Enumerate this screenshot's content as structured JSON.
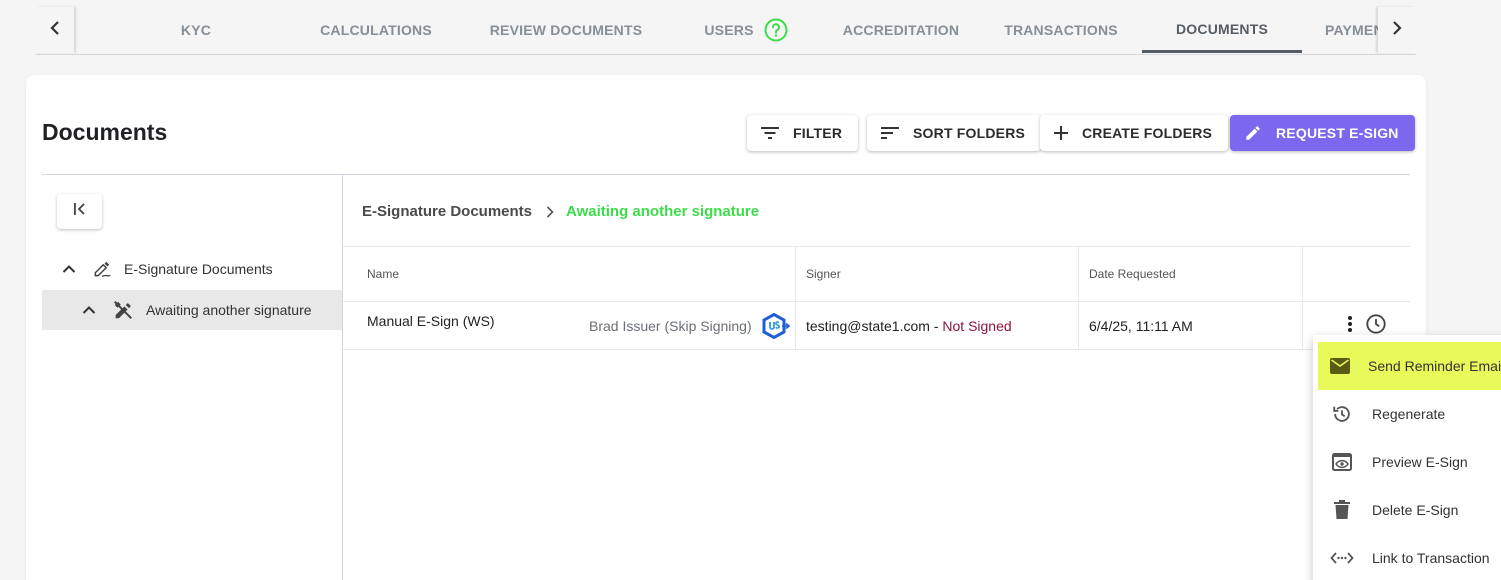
{
  "tabs": [
    {
      "label": "KYC"
    },
    {
      "label": "CALCULATIONS"
    },
    {
      "label": "REVIEW DOCUMENTS"
    },
    {
      "label": "USERS"
    },
    {
      "label": "ACCREDITATION"
    },
    {
      "label": "TRANSACTIONS"
    },
    {
      "label": "DOCUMENTS"
    },
    {
      "label": "PAYMENT METHODS"
    }
  ],
  "active_tab": "DOCUMENTS",
  "colors": {
    "accent": "#7b68ee",
    "help_green": "#3ddc4a",
    "breadcrumb_current": "#3ddc4a",
    "not_signed": "#8b1538",
    "menu_highlight": "#e8f95a"
  },
  "page": {
    "title": "Documents"
  },
  "toolbar": {
    "filter_label": "FILTER",
    "sort_label": "SORT FOLDERS",
    "create_label": "CREATE FOLDERS",
    "request_label": "REQUEST E-SIGN"
  },
  "tree": {
    "root_label": "E-Signature Documents",
    "child_label": "Awaiting another signature"
  },
  "breadcrumb": {
    "root": "E-Signature Documents",
    "current": "Awaiting another signature"
  },
  "table": {
    "headers": {
      "name": "Name",
      "signer": "Signer",
      "date": "Date Requested"
    },
    "rows": [
      {
        "name": "Manual E-Sign (WS)",
        "owner": "Brad Issuer (Skip Signing)",
        "signer_email": "testing@state1.com",
        "signer_sep": " - ",
        "signer_status": "Not Signed",
        "date": "6/4/25, 11:11 AM"
      }
    ]
  },
  "menu": {
    "items": [
      {
        "label": "Send Reminder Email",
        "icon": "mail-icon"
      },
      {
        "label": "Regenerate",
        "icon": "history-icon"
      },
      {
        "label": "Preview E-Sign",
        "icon": "preview-icon"
      },
      {
        "label": "Delete E-Sign",
        "icon": "trash-icon"
      },
      {
        "label": "Link to Transaction",
        "icon": "link-icon"
      }
    ]
  }
}
